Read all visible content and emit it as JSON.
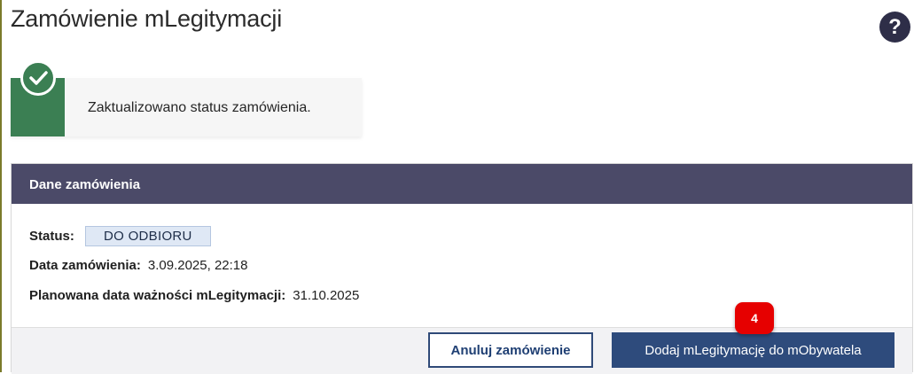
{
  "page": {
    "title": "Zamówienie mLegitymacji",
    "help_icon": "question-icon",
    "help_glyph": "?"
  },
  "alert": {
    "message": "Zaktualizowano status zamówienia.",
    "icon": "check-circle-icon",
    "color": "#3b7f53"
  },
  "order": {
    "header": "Dane zamówienia",
    "status_label": "Status:",
    "status_value": "DO ODBIORU",
    "date_label": "Data zamówienia:",
    "date_value": "3.09.2025, 22:18",
    "validity_label": "Planowana data ważności mLegitymacji:",
    "validity_value": "31.10.2025"
  },
  "actions": {
    "cancel_label": "Anuluj zamówienie",
    "add_label": "Dodaj mLegitymację do mObywatela"
  },
  "step_marker": "4",
  "colors": {
    "header_bg": "#4b4a68",
    "primary": "#2e4b7c",
    "marker": "#e60000"
  }
}
